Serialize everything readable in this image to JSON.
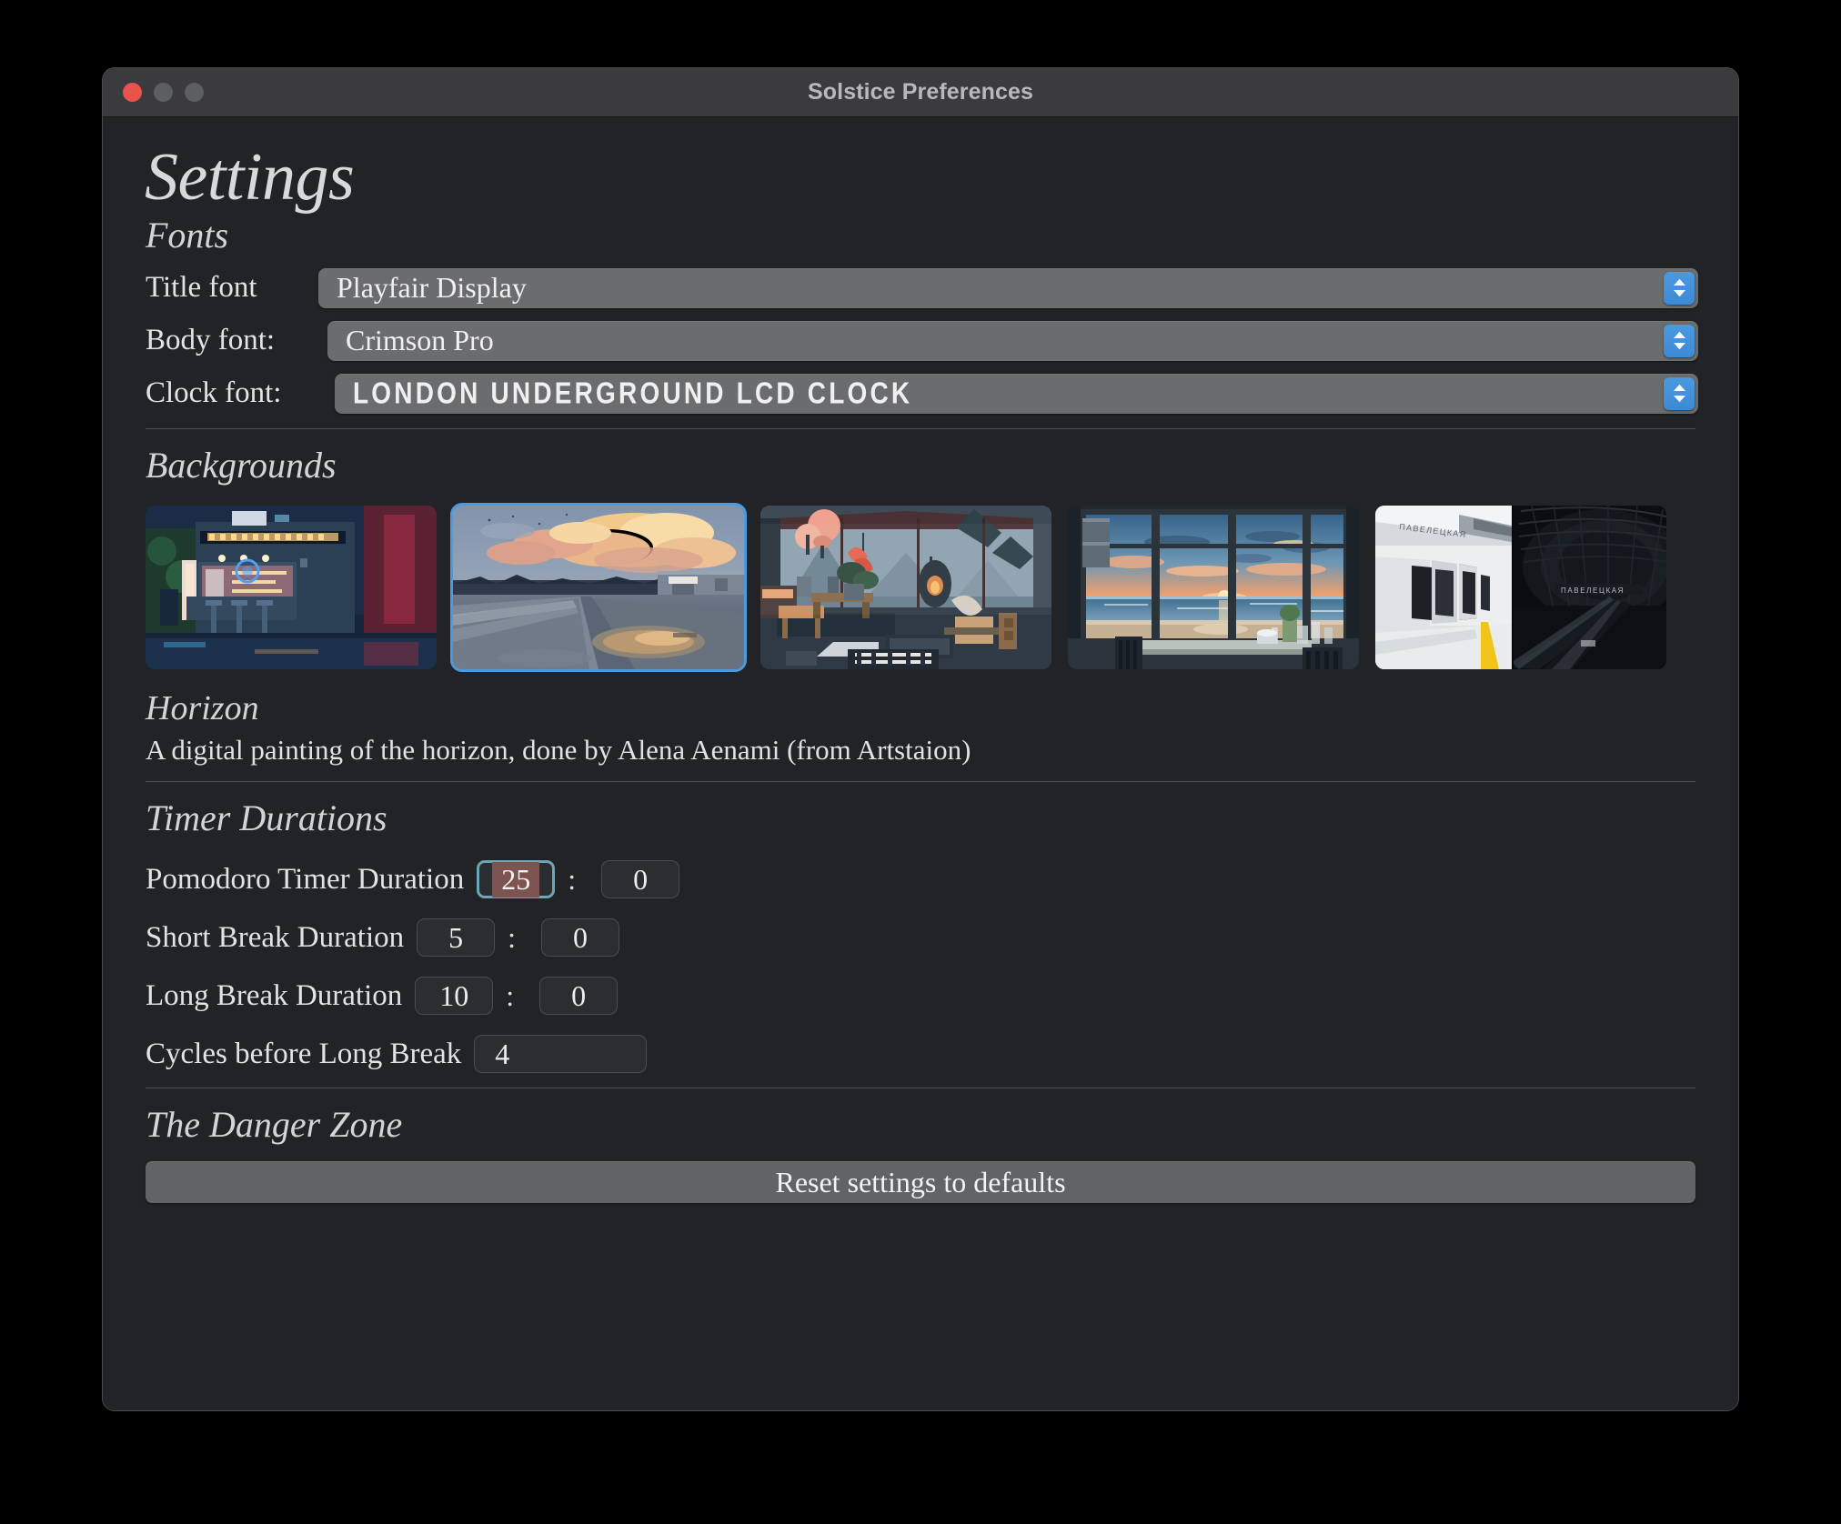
{
  "window": {
    "title": "Solstice Preferences",
    "traffic_lights": [
      "close",
      "minimize",
      "maximize"
    ],
    "accent_blue": "#4a9ae0",
    "close_red": "#e8544a",
    "focus_teal": "#6ba6b4",
    "selection_red": "#7d5450",
    "background": "#222326",
    "titlebar": "#3b3b3d"
  },
  "page": {
    "title": "Settings"
  },
  "fonts_section": {
    "heading": "Fonts",
    "rows": [
      {
        "label": "Title font",
        "value": "Playfair Display",
        "stepper_icon": "updown-chevron-icon"
      },
      {
        "label": "Body font:",
        "value": "Crimson Pro",
        "stepper_icon": "updown-chevron-icon"
      },
      {
        "label": "Clock font:",
        "value": "LONDON UNDERGROUND LCD CLOCK",
        "stepper_icon": "updown-chevron-icon"
      }
    ]
  },
  "backgrounds_section": {
    "heading": "Backgrounds",
    "thumbnails": [
      {
        "name": "neon-cafe-night",
        "selected": false
      },
      {
        "name": "sunset-road-clouds",
        "selected": true
      },
      {
        "name": "cozy-cabin-interior",
        "selected": false
      },
      {
        "name": "beach-window-sunset",
        "selected": false
      },
      {
        "name": "metro-station",
        "selected": false
      }
    ],
    "selected_title": "Horizon",
    "selected_description": "A digital painting of the horizon, done by Alena Aenami (from Artstaion)"
  },
  "timers_section": {
    "heading": "Timer Durations",
    "rows": [
      {
        "label": "Pomodoro Timer Duration",
        "minutes": "25",
        "seconds": "0",
        "focused": true,
        "separator": ":"
      },
      {
        "label": "Short Break Duration",
        "minutes": "5",
        "seconds": "0",
        "focused": false,
        "separator": ":"
      },
      {
        "label": "Long Break Duration",
        "minutes": "10",
        "seconds": "0",
        "focused": false,
        "separator": ":"
      }
    ],
    "cycles_label": "Cycles before Long Break",
    "cycles_value": "4"
  },
  "danger_section": {
    "heading": "The Danger Zone",
    "reset_label": "Reset settings to defaults"
  }
}
